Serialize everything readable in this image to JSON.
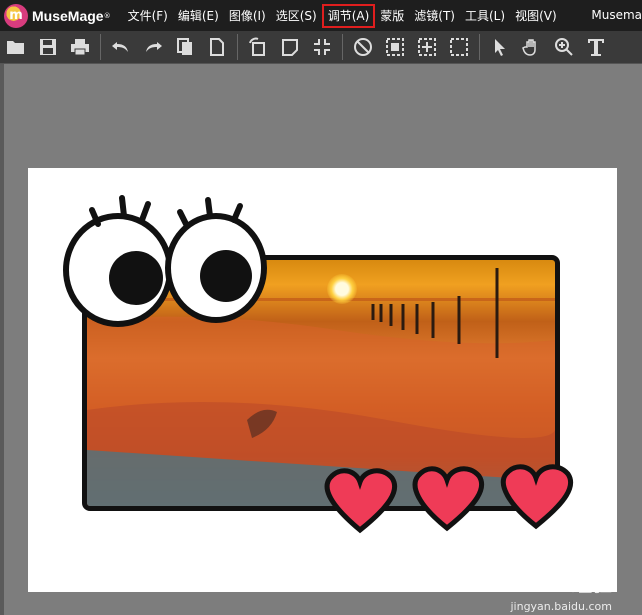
{
  "app": {
    "logo_letter": "m",
    "name": "MuseMage",
    "tm": "®",
    "title_right": "Musema"
  },
  "menu": [
    {
      "label": "文件(F)",
      "active": false
    },
    {
      "label": "编辑(E)",
      "active": false
    },
    {
      "label": "图像(I)",
      "active": false
    },
    {
      "label": "选区(S)",
      "active": false
    },
    {
      "label": "调节(A)",
      "active": true
    },
    {
      "label": "蒙版",
      "active": false
    },
    {
      "label": "滤镜(T)",
      "active": false
    },
    {
      "label": "工具(L)",
      "active": false
    },
    {
      "label": "视图(V)",
      "active": false
    }
  ],
  "toolbar": {
    "icons": [
      "open-folder-icon",
      "save-icon",
      "print-icon",
      "undo-icon",
      "redo-icon",
      "copy-icon",
      "new-page-icon",
      "rotate-icon",
      "flip-icon",
      "fit-icon",
      "no-select-icon",
      "select-rect-icon",
      "select-move-icon",
      "select-dashed-icon",
      "pointer-icon",
      "hand-icon",
      "zoom-icon",
      "text-icon"
    ]
  },
  "watermark": {
    "main": "Baidu 经验",
    "sub": "jingyan.baidu.com"
  },
  "colors": {
    "menubar": "#1e1e1e",
    "toolbar": "#3a3a3a",
    "workspace": "#7d7d7d",
    "highlight": "#e01e1e",
    "heart": "#ef3b57"
  }
}
